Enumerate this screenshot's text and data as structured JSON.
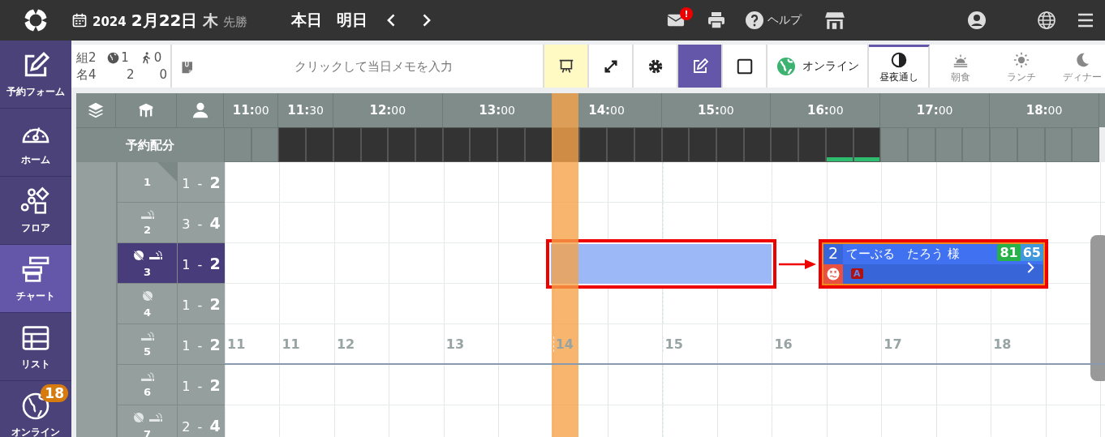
{
  "header": {
    "year": "2024",
    "date": "2月22日",
    "weekday": "木",
    "rokuyo": "先勝",
    "today": "本日",
    "tomorrow": "明日",
    "mail_badge": "!",
    "help": "ヘルプ"
  },
  "sidebar": {
    "items": [
      {
        "label": "予約フォーム",
        "kind": "edit",
        "selected": false
      },
      {
        "label": "ホーム",
        "kind": "gauge",
        "selected": false
      },
      {
        "label": "フロア",
        "kind": "shapes",
        "selected": false
      },
      {
        "label": "チャート",
        "kind": "chart",
        "selected": true
      },
      {
        "label": "リスト",
        "kind": "table",
        "selected": false
      },
      {
        "label": "オンライン",
        "kind": "globe",
        "selected": false,
        "badge": "18"
      }
    ]
  },
  "stats": {
    "groups_label": "組",
    "groups": "2",
    "online_groups": "1",
    "walkin_groups": "0",
    "people_label": "名",
    "people": "4",
    "online_people": "2",
    "walkin_people": "0"
  },
  "memo": {
    "placeholder": "クリックして当日メモを入力"
  },
  "toolbar": {
    "buttons": [
      {
        "kind": "present",
        "selected": true
      },
      {
        "kind": "expand",
        "selected": false
      },
      {
        "kind": "settings",
        "selected": false
      },
      {
        "kind": "edit",
        "selected": true
      },
      {
        "kind": "square",
        "selected": false
      }
    ],
    "online_label": "オンライン",
    "meal_tabs": [
      {
        "label": "昼夜通し",
        "kind": "halfmoon",
        "selected": true
      },
      {
        "label": "朝食",
        "kind": "sunrise",
        "selected": false
      },
      {
        "label": "ランチ",
        "kind": "sun",
        "selected": false
      },
      {
        "label": "ディナー",
        "kind": "moon",
        "selected": false
      }
    ]
  },
  "chart": {
    "hours": [
      {
        "time": "**11:**00",
        "half": true
      },
      {
        "time": "**11:**30",
        "half": true
      },
      {
        "time": "**12:**00",
        "half": false
      },
      {
        "time": "**13:**00",
        "half": false
      },
      {
        "time": "**14:**00",
        "half": false
      },
      {
        "time": "**15:**00",
        "half": false
      },
      {
        "time": "**16:**00",
        "half": false
      },
      {
        "time": "**17:**00",
        "half": false
      },
      {
        "time": "**18:**00",
        "half": false
      }
    ],
    "allocation_label": "予約配分",
    "allocation": [
      {
        "open": false,
        "booked": false
      },
      {
        "open": false,
        "booked": false
      },
      {
        "open": true,
        "booked": false
      },
      {
        "open": true,
        "booked": false
      },
      {
        "open": true,
        "booked": false
      },
      {
        "open": true,
        "booked": false
      },
      {
        "open": true,
        "booked": false
      },
      {
        "open": true,
        "booked": false
      },
      {
        "open": true,
        "booked": false
      },
      {
        "open": true,
        "booked": false
      },
      {
        "open": true,
        "booked": false
      },
      {
        "open": true,
        "booked": false
      },
      {
        "open": true,
        "booked": false
      },
      {
        "open": true,
        "booked": false
      },
      {
        "open": true,
        "booked": false
      },
      {
        "open": true,
        "booked": false
      },
      {
        "open": true,
        "booked": false
      },
      {
        "open": true,
        "booked": false
      },
      {
        "open": true,
        "booked": false
      },
      {
        "open": true,
        "booked": false
      },
      {
        "open": true,
        "booked": false
      },
      {
        "open": true,
        "booked": false
      },
      {
        "open": true,
        "booked": true
      },
      {
        "open": true,
        "booked": true
      },
      {
        "open": false,
        "booked": false
      },
      {
        "open": false,
        "booked": false
      },
      {
        "open": false,
        "booked": false
      },
      {
        "open": false,
        "booked": false
      },
      {
        "open": false,
        "booked": false
      },
      {
        "open": false,
        "booked": false
      },
      {
        "open": false,
        "booked": false
      },
      {
        "open": false,
        "booked": false
      }
    ],
    "tables": [
      {
        "number": "1",
        "capacity": "1 - **2**",
        "smoking": false,
        "online_blocked": false,
        "selected": false,
        "flagged": true,
        "group_end": false
      },
      {
        "number": "2",
        "capacity": "3 - **4**",
        "smoking": true,
        "online_blocked": false,
        "selected": false,
        "flagged": false,
        "group_end": false
      },
      {
        "number": "3",
        "capacity": "1 - **2**",
        "smoking": true,
        "online_blocked": true,
        "selected": true,
        "flagged": false,
        "group_end": false
      },
      {
        "number": "4",
        "capacity": "1 - **2**",
        "smoking": false,
        "online_blocked": true,
        "selected": false,
        "flagged": false,
        "group_end": false
      },
      {
        "number": "5",
        "capacity": "1 - **2**",
        "smoking": true,
        "online_blocked": false,
        "selected": false,
        "flagged": false,
        "group_end": true,
        "hour_marks": [
          "11",
          "11",
          "12",
          "13",
          "14",
          "15",
          "16",
          "17",
          "18"
        ]
      },
      {
        "number": "6",
        "capacity": "1 - **2**",
        "smoking": true,
        "online_blocked": false,
        "selected": false,
        "flagged": false,
        "group_end": false
      },
      {
        "number": "7",
        "capacity": "2 - **4**",
        "smoking": true,
        "online_blocked": true,
        "selected": false,
        "flagged": false,
        "group_end": false
      }
    ],
    "reservation": {
      "party": "2",
      "name": "てーぶる　たろう 様",
      "score_a": "81",
      "score_b": "65",
      "tag": "A"
    }
  }
}
